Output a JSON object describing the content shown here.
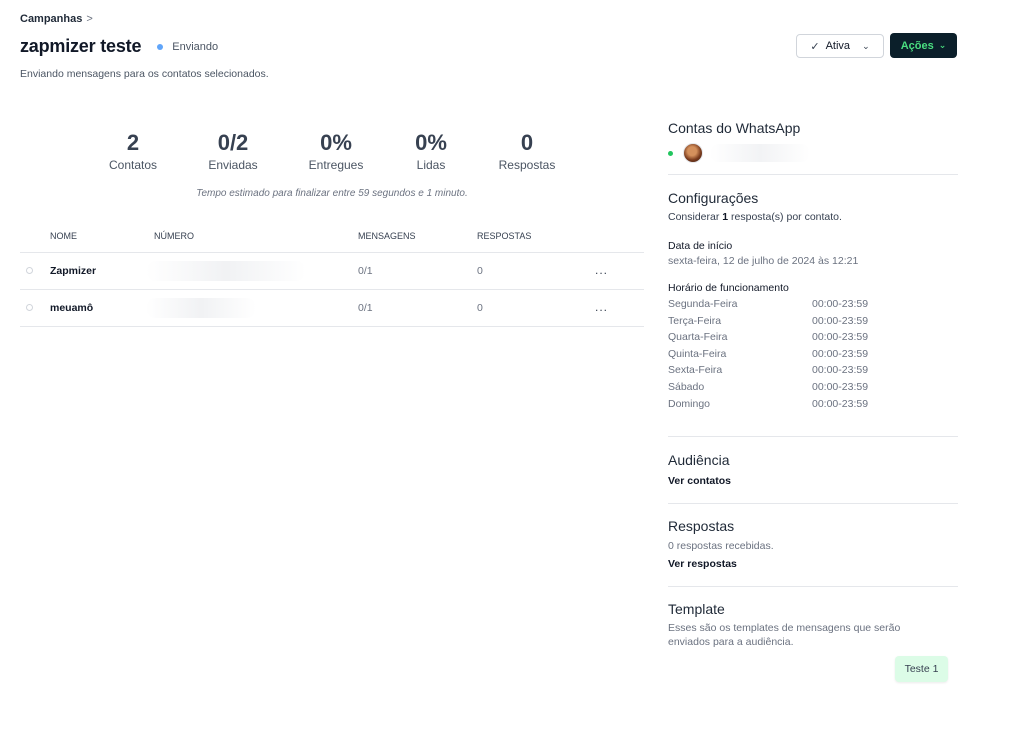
{
  "breadcrumb": {
    "label": "Campanhas",
    "separator": ">"
  },
  "campaign": {
    "title": "zapmizer teste",
    "status": "Enviando",
    "status_color": "#60a5fa",
    "description": "Enviando mensagens para os contatos selecionados."
  },
  "actions": {
    "status_select": {
      "check_icon": "✓",
      "label": "Ativa",
      "chevron": "⌄"
    },
    "actions_button": {
      "label": "Ações",
      "chevron": "⌄",
      "bg_color": "#0b1f2a",
      "text_color": "#4ade80"
    }
  },
  "stats": [
    {
      "value": "2",
      "label": "Contatos"
    },
    {
      "value": "0/2",
      "label": "Enviadas"
    },
    {
      "value": "0%",
      "label": "Entregues"
    },
    {
      "value": "0%",
      "label": "Lidas"
    },
    {
      "value": "0",
      "label": "Respostas"
    }
  ],
  "estimate": "Tempo estimado para finalizar entre 59 segundos e 1 minuto.",
  "table": {
    "columns": [
      "NOME",
      "NÚMERO",
      "MENSAGENS",
      "RESPOSTAS"
    ],
    "rows": [
      {
        "name": "Zapmizer",
        "messages": "0/1",
        "responses": "0",
        "more": "..."
      },
      {
        "name": "meuamô",
        "messages": "0/1",
        "responses": "0",
        "more": "..."
      }
    ]
  },
  "sidebar": {
    "accounts": {
      "title": "Contas do WhatsApp",
      "online_color": "#22c55e"
    },
    "settings": {
      "title": "Configurações",
      "response_prefix": "Considerar ",
      "response_count": "1",
      "response_suffix": " resposta(s) por contato.",
      "start_label": "Data de início",
      "start_value": "sexta-feira, 12 de julho de 2024 às 12:21",
      "hours_label": "Horário de funcionamento",
      "hours": [
        {
          "day": "Segunda-Feira",
          "time": "00:00-23:59"
        },
        {
          "day": "Terça-Feira",
          "time": "00:00-23:59"
        },
        {
          "day": "Quarta-Feira",
          "time": "00:00-23:59"
        },
        {
          "day": "Quinta-Feira",
          "time": "00:00-23:59"
        },
        {
          "day": "Sexta-Feira",
          "time": "00:00-23:59"
        },
        {
          "day": "Sábado",
          "time": "00:00-23:59"
        },
        {
          "day": "Domingo",
          "time": "00:00-23:59"
        }
      ]
    },
    "audience": {
      "title": "Audiência",
      "link": "Ver contatos"
    },
    "responses": {
      "title": "Respostas",
      "summary": "0 respostas recebidas.",
      "link": "Ver respostas"
    },
    "template": {
      "title": "Template",
      "description": "Esses são os templates de mensagens que serão enviados para a audiência.",
      "badge": "Teste 1"
    }
  }
}
